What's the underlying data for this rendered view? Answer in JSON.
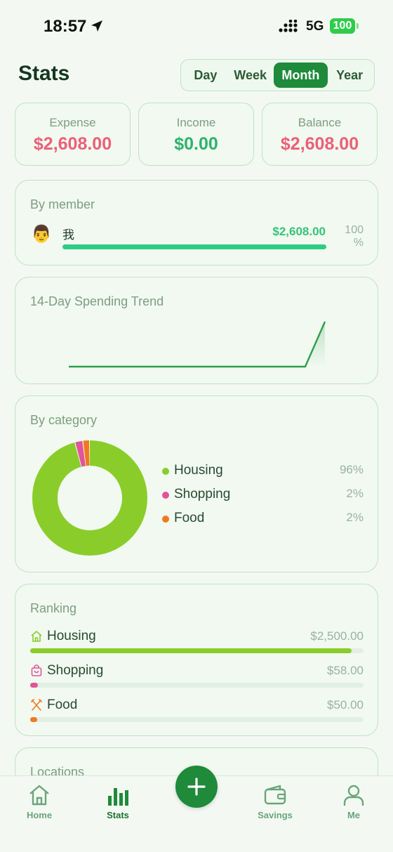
{
  "status_bar": {
    "time": "18:57",
    "network": "5G",
    "battery": "100"
  },
  "header": {
    "title": "Stats",
    "periods": [
      "Day",
      "Week",
      "Month",
      "Year"
    ],
    "active_period": "Month"
  },
  "summary": {
    "expense": {
      "label": "Expense",
      "value": "$2,608.00"
    },
    "income": {
      "label": "Income",
      "value": "$0.00"
    },
    "balance": {
      "label": "Balance",
      "value": "$2,608.00"
    }
  },
  "by_member": {
    "title": "By member",
    "members": [
      {
        "avatar": "👨",
        "name": "我",
        "amount": "$2,608.00",
        "percent": "100",
        "percent_unit": "%",
        "share": 1.0
      }
    ]
  },
  "trend": {
    "title": "14-Day Spending Trend",
    "values": [
      0,
      0,
      0,
      0,
      0,
      0,
      0,
      0,
      0,
      0,
      0,
      0,
      0,
      2608
    ],
    "color": "#2e9e4c"
  },
  "by_category": {
    "title": "By category",
    "items": [
      {
        "name": "Housing",
        "percent": "96%",
        "share": 0.959,
        "color": "#8acd2a"
      },
      {
        "name": "Shopping",
        "percent": "2%",
        "share": 0.022,
        "color": "#e2549a"
      },
      {
        "name": "Food",
        "percent": "2%",
        "share": 0.019,
        "color": "#ef7a1e"
      }
    ]
  },
  "ranking": {
    "title": "Ranking",
    "items": [
      {
        "name": "Housing",
        "amount": "$2,500.00",
        "value": 2500,
        "color": "#8acd2a",
        "icon": "house-icon"
      },
      {
        "name": "Shopping",
        "amount": "$58.00",
        "value": 58,
        "color": "#e2549a",
        "icon": "shopping-bag-icon"
      },
      {
        "name": "Food",
        "amount": "$50.00",
        "value": 50,
        "color": "#ef7a1e",
        "icon": "utensils-icon"
      }
    ]
  },
  "locations": {
    "title": "Locations"
  },
  "tab_bar": {
    "tabs": [
      {
        "label": "Home",
        "icon": "home-icon"
      },
      {
        "label": "Stats",
        "icon": "bar-chart-icon"
      },
      {
        "label": "Savings",
        "icon": "wallet-icon"
      },
      {
        "label": "Me",
        "icon": "person-icon"
      }
    ],
    "active": "Stats",
    "fab_icon": "plus-icon"
  },
  "colors": {
    "accent": "#1e8a3a",
    "expense": "#ec5f78",
    "income": "#2db36e"
  }
}
